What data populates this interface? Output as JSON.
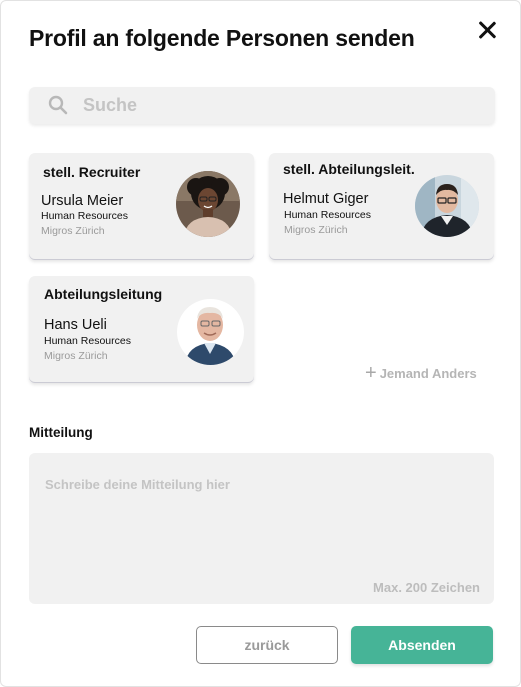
{
  "dialog": {
    "title": "Profil an folgende Personen senden"
  },
  "search": {
    "placeholder": "Suche"
  },
  "recipients": [
    {
      "role": "stell. Recruiter",
      "name": "Ursula Meier",
      "department": "Human Resources",
      "organization": "Migros Zürich"
    },
    {
      "role": "stell. Abteilungsleit.",
      "name": "Helmut Giger",
      "department": "Human Resources",
      "organization": "Migros Zürich"
    },
    {
      "role": "Abteilungsleitung",
      "name": "Hans Ueli",
      "department": "Human Resources",
      "organization": "Migros Zürich"
    }
  ],
  "add_other": {
    "label": "Jemand Anders"
  },
  "message": {
    "label": "Mitteilung",
    "placeholder": "Schreibe deine Mitteilung hier",
    "max_hint": "Max. 200 Zeichen"
  },
  "actions": {
    "back_label": "zurück",
    "send_label": "Absenden"
  },
  "colors": {
    "accent": "#46b497",
    "card_bg": "#f1f1f1",
    "muted_text": "#9a9a9a"
  }
}
